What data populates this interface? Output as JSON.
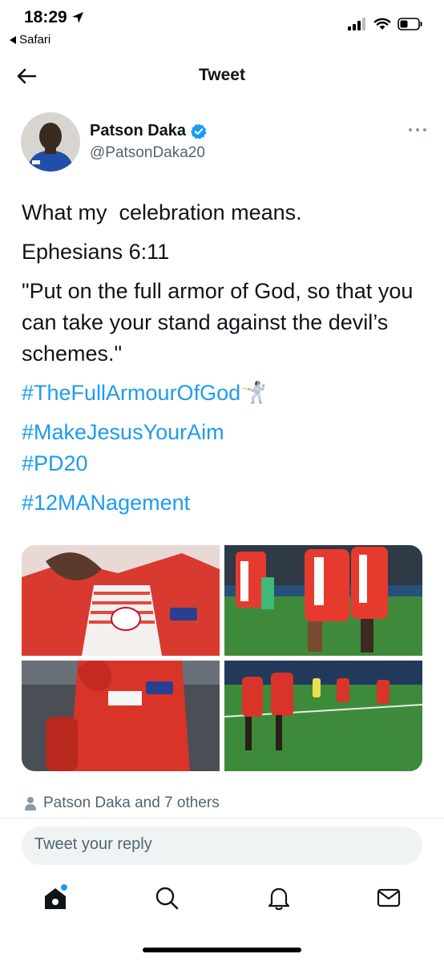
{
  "status_bar": {
    "time": "18:29",
    "back_app": "Safari"
  },
  "nav": {
    "title": "Tweet"
  },
  "author": {
    "name": "Patson Daka",
    "handle": "@PatsonDaka20",
    "verified": true
  },
  "tweet": {
    "line1": "What my  celebration means.",
    "line2": "Ephesians 6:11",
    "line3": "\"Put on the full armor of God, so that you can take your stand against the devil’s schemes.\"",
    "hashtags": [
      "#TheFullArmourOfGod",
      "#MakeJesusYourAim",
      "#PD20",
      "#12MANagement"
    ],
    "fencer_emoji": "🤺"
  },
  "liked_by": "Patson Daka and 7 others",
  "reply": {
    "placeholder": "Tweet your reply"
  },
  "colors": {
    "accent": "#1d9bf0",
    "text": "#0f1419",
    "muted": "#536471"
  },
  "tabs": [
    "home-icon",
    "search-icon",
    "notifications-icon",
    "messages-icon"
  ]
}
